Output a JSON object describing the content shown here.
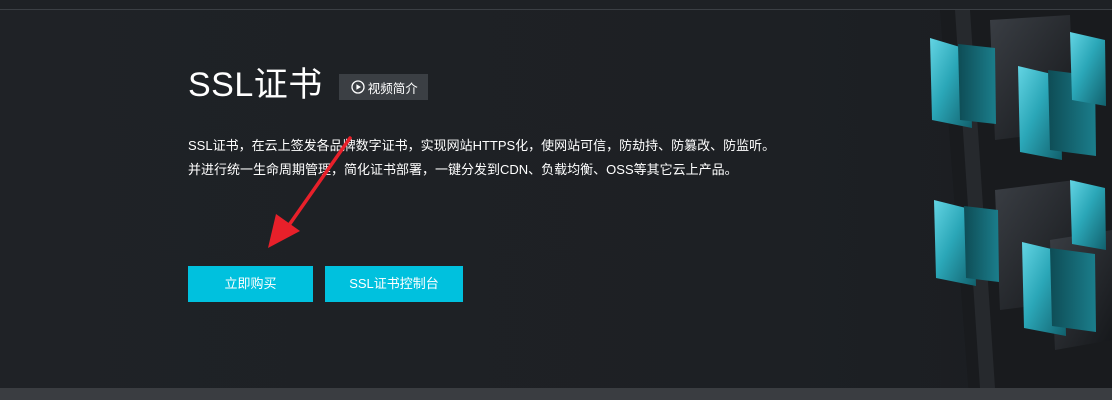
{
  "hero": {
    "title": "SSL证书",
    "video_button_label": "视频简介",
    "description_lines": [
      "SSL证书，在云上签发各品牌数字证书，实现网站HTTPS化，使网站可信，防劫持、防篡改、防监听。",
      "并进行统一生命周期管理，简化证书部署，一键分发到CDN、负载均衡、OSS等其它云上产品。"
    ],
    "buttons": {
      "buy_label": "立即购买",
      "console_label": "SSL证书控制台"
    }
  },
  "icons": {
    "video": "play-circle-icon",
    "annotation": "red-arrow-icon",
    "decoration": "cube-graphic-icon"
  },
  "colors": {
    "background": "#1e2125",
    "accent": "#00c1de",
    "secondary_button": "#3b3f44",
    "arrow": "#e8202a"
  }
}
